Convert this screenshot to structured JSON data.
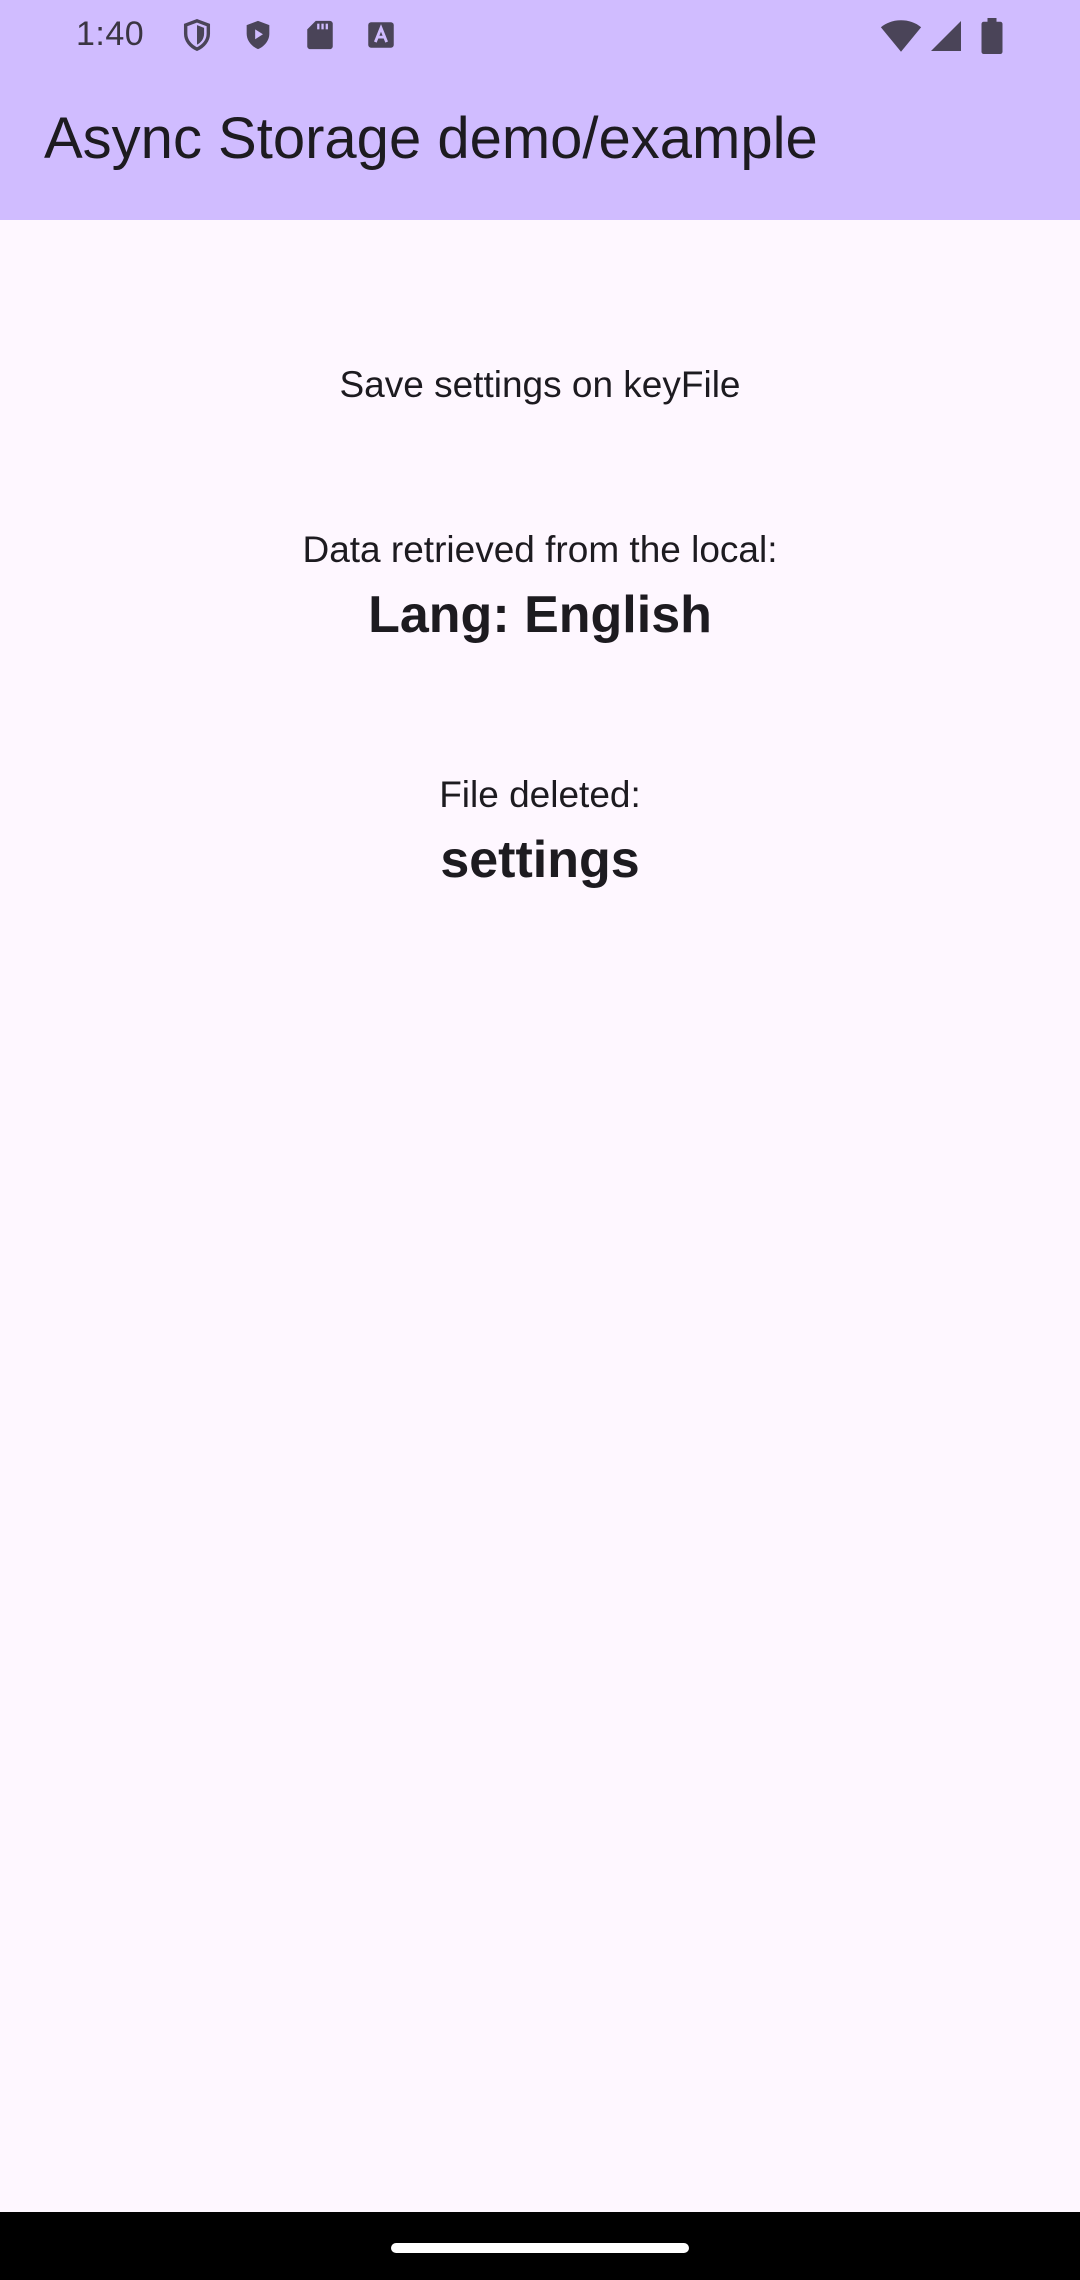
{
  "status_bar": {
    "time": "1:40",
    "left_icons": [
      "shield-outline-icon",
      "shield-play-icon",
      "sd-card-icon",
      "font-a-icon"
    ],
    "right_icons": [
      "wifi-icon",
      "signal-icon",
      "battery-icon"
    ]
  },
  "app_bar": {
    "title": "Async Storage demo/example",
    "background": "#d0bcff"
  },
  "main": {
    "save_message": "Save settings on keyFile",
    "retrieved_label": "Data retrieved from the local:",
    "retrieved_value": "Lang: English",
    "deleted_label": "File deleted:",
    "deleted_value": "settings"
  },
  "colors": {
    "background": "#fef7ff",
    "text": "#1d1b20",
    "nav_bar": "#000000"
  }
}
